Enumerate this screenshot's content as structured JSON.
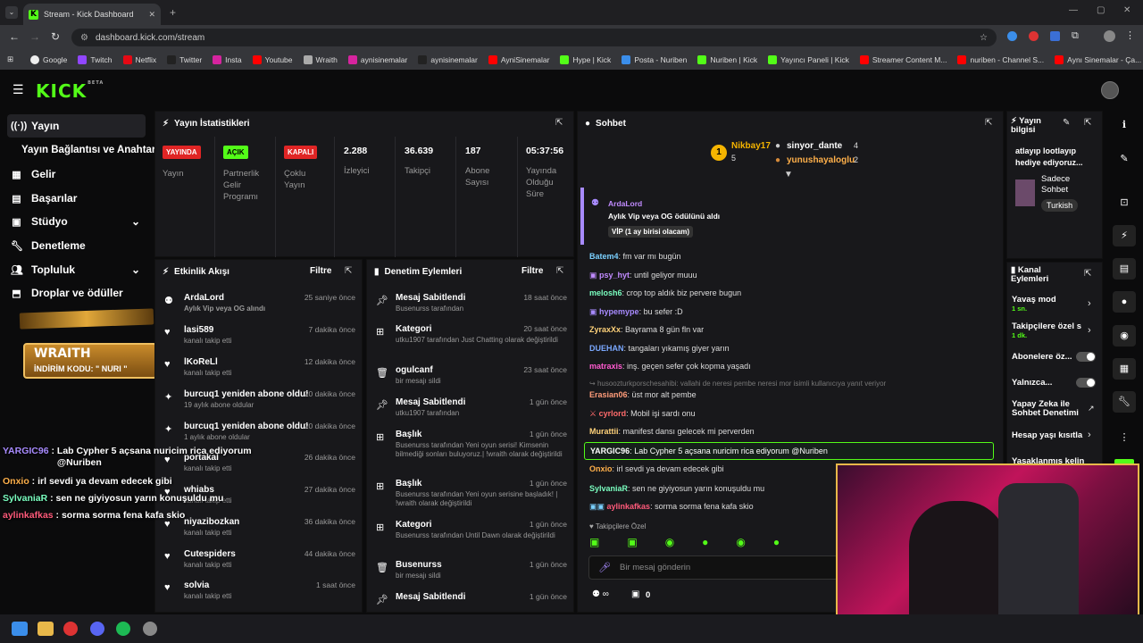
{
  "browser": {
    "tab_title": "Stream - Kick Dashboard",
    "url": "dashboard.kick.com/stream",
    "bookmarks": [
      "Google",
      "Twitch",
      "Netflix",
      "Twitter",
      "Insta",
      "Youtube",
      "Wraith",
      "aynisinemalar",
      "aynisinemalar",
      "AyniSinemalar",
      "Hype | Kick",
      "Posta - Nuriben",
      "Nuriben | Kick",
      "Yayıncı Paneli | Kick",
      "Streamer Content M...",
      "nuriben - Channel S...",
      "Aynı Sinemalar - Ça..."
    ]
  },
  "brand": {
    "logo": "KICK",
    "beta": "BETA",
    "accent": "#53fc18"
  },
  "sidebar": {
    "items": [
      "Yayın",
      "Yayın Bağlantısı ve Anahtarı",
      "Gelir",
      "Başarılar",
      "Stüdyo",
      "Denetleme",
      "Topluluk",
      "Droplar ve ödüller"
    ]
  },
  "stats": {
    "title": "Yayın İstatistikleri",
    "items": [
      {
        "badge": "YAYINDA",
        "label": "Yayın"
      },
      {
        "badge": "AÇIK",
        "label": "Partnerlik Gelir Programı"
      },
      {
        "badge": "KAPALI",
        "label": "Çoklu Yayın"
      },
      {
        "value": "2.288",
        "label": "İzleyici"
      },
      {
        "value": "36.639",
        "label": "Takipçi"
      },
      {
        "value": "187",
        "label": "Abone Sayısı"
      },
      {
        "value": "05:37:56",
        "label": "Yayında Olduğu Süre"
      }
    ]
  },
  "activity": {
    "title": "Etkinlik Akışı",
    "filter": "Filtre",
    "rows": [
      {
        "name": "ArdaLord",
        "time": "25 saniye önce",
        "sub": "Aylık Vip veya OG alındı"
      },
      {
        "name": "lasi589",
        "time": "7 dakika önce",
        "sub": "kanalı takip etti"
      },
      {
        "name": "lKoReLl",
        "time": "12 dakika önce",
        "sub": "kanalı takip etti"
      },
      {
        "name": "burcuq1 yeniden abone oldu!",
        "time": "20 dakika önce",
        "sub": "19 aylık abone oldular"
      },
      {
        "name": "burcuq1 yeniden abone oldu!",
        "time": "20 dakika önce",
        "sub": "1 aylık abone oldular"
      },
      {
        "name": "portakal",
        "time": "26 dakika önce",
        "sub": "kanalı takip etti"
      },
      {
        "name": "whiabs",
        "time": "27 dakika önce",
        "sub": "kanalı takip etti"
      },
      {
        "name": "niyazibozkan",
        "time": "36 dakika önce",
        "sub": "kanalı takip etti"
      },
      {
        "name": "Cutespiders",
        "time": "44 dakika önce",
        "sub": "kanalı takip etti"
      },
      {
        "name": "solvia",
        "time": "1 saat önce",
        "sub": "kanalı takip etti"
      }
    ]
  },
  "moderation": {
    "title": "Denetim Eylemleri",
    "filter": "Filtre",
    "rows": [
      {
        "name": "Mesaj Sabitlendi",
        "time": "18 saat önce",
        "sub": "Busenurss tarafından"
      },
      {
        "name": "Kategori",
        "time": "20 saat önce",
        "sub": "utku1907 tarafından Just Chatting olarak değiştirildi"
      },
      {
        "name": "ogulcanf",
        "time": "23 saat önce",
        "sub": "bir mesajı sildi"
      },
      {
        "name": "Mesaj Sabitlendi",
        "time": "1 gün önce",
        "sub": "utku1907 tarafından"
      },
      {
        "name": "Başlık",
        "time": "1 gün önce",
        "sub": "Busenurss tarafından Yeni oyun serisi! Kimsenin bilmediği sonları buluyoruz.| !wraith olarak değiştirildi"
      },
      {
        "name": "Başlık",
        "time": "1 gün önce",
        "sub": "Busenurss tarafından Yeni oyun serisine başladık! | !wraith olarak değiştirildi"
      },
      {
        "name": "Kategori",
        "time": "1 gün önce",
        "sub": "Busenurss tarafından Until Dawn olarak değiştirildi"
      },
      {
        "name": "Busenurss",
        "time": "1 gün önce",
        "sub": "bir mesajı sildi"
      },
      {
        "name": "Mesaj Sabitlendi",
        "time": "1 gün önce",
        "sub": ""
      }
    ]
  },
  "chat": {
    "title": "Sohbet",
    "leaders": {
      "first": "Nikbay17",
      "first_count": "5",
      "second": "sinyor_dante",
      "second_count": "4",
      "third": "yunushayaloglu",
      "third_count": "2"
    },
    "reward": {
      "user": "ArdaLord",
      "text": "Aylık Vip veya OG ödülünü aldı",
      "tag": "VİP (1 ay birisi olacam)"
    },
    "messages": [
      {
        "user": "Batem4",
        "text": "fm var mı bugün",
        "color": "#7ad0ff"
      },
      {
        "user": "psy_hyt",
        "text": "until geliyor muuu",
        "color": "#c18bff"
      },
      {
        "user": "melosh6",
        "text": "crop top aldık biz pervere bugun",
        "color": "#7affc0"
      },
      {
        "user": "hypemype",
        "text": "bu sefer :D",
        "color": "#a88bff"
      },
      {
        "user": "ZyraxXx",
        "text": "Bayrama 8 gün fln var",
        "color": "#ffd27a"
      },
      {
        "user": "DUEHAN",
        "text": "tangaları yıkamış giyer yarın",
        "color": "#7aa8ff"
      },
      {
        "user": "matraxis",
        "text": "inş. geçen sefer çok kopma yaşadı",
        "color": "#ff5ad0"
      },
      {
        "user": "Erasian06",
        "text": "üst mor alt pembe",
        "color": "#ff9c7a"
      },
      {
        "user": "cyrlord",
        "text": "Mobil işi sardı onu",
        "color": "#ff6b6b"
      },
      {
        "user": "Murattii",
        "text": "manifest dansı gelecek mi perverden",
        "color": "#ffd27a"
      },
      {
        "user": "Onxio",
        "text": "irl sevdi ya devam edecek gibi",
        "color": "#ffb04a"
      },
      {
        "user": "SylvaniaR",
        "text": "sen ne giyiyosun yarın konuşuldu mu",
        "color": "#7affc0"
      },
      {
        "user": "aylinkafkas",
        "text": "sorma sorma fena kafa skio",
        "color": "#ff5a7a"
      }
    ],
    "reply": "husoozturkporschesahibi: vallahi de neresi pembe neresi mor isimli kullanıcıya yanıt veriyor",
    "highlight": {
      "user": "YARGIC96",
      "text": "Lab Cypher 5 açsana nuricim rica ediyorum @Nuriben"
    },
    "followers_only": "Takipçilere Özel",
    "placeholder": "Bir mesaj gönderin",
    "count": "0"
  },
  "stream_info": {
    "title": "Yayın bilgisi",
    "text": "atlayıp lootlayıp hediye ediyoruz...",
    "category": "Sadece Sohbet",
    "language": "Turkish"
  },
  "channel_actions": {
    "title": "Kanal Eylemleri",
    "items": [
      {
        "label": "Yavaş mod",
        "sub": "1 sn."
      },
      {
        "label": "Takipçilere özel s",
        "sub": "1 dk."
      },
      {
        "label": "Abonelere öz...",
        "sub": ""
      },
      {
        "label": "Yalnızca...",
        "sub": ""
      },
      {
        "label": "Yapay Zeka ile Sohbet Denetimi",
        "sub": ""
      },
      {
        "label": "Hesap yaşı kısıtla",
        "sub": ""
      },
      {
        "label": "Yasaklanmış kelin",
        "sub": ""
      }
    ]
  },
  "overlay": {
    "sponsor": "WRAITH",
    "code": "İNDİRİM KODU: \" NURI \"",
    "chat": [
      {
        "user": "YARGIC96",
        "text": "Lab Cypher 5 açsana nuricim rica ediyorum @Nuriben",
        "color": "#a88bff"
      },
      {
        "user": "Onxio",
        "text": "irl sevdi ya devam edecek gibi",
        "color": "#ffb04a"
      },
      {
        "user": "SylvaniaR",
        "text": "sen ne giyiyosun yarın konuşuldu mu",
        "color": "#7affc0"
      },
      {
        "user": "aylinkafkas",
        "text": "sorma sorma fena kafa skio",
        "color": "#ff5a7a"
      }
    ]
  }
}
